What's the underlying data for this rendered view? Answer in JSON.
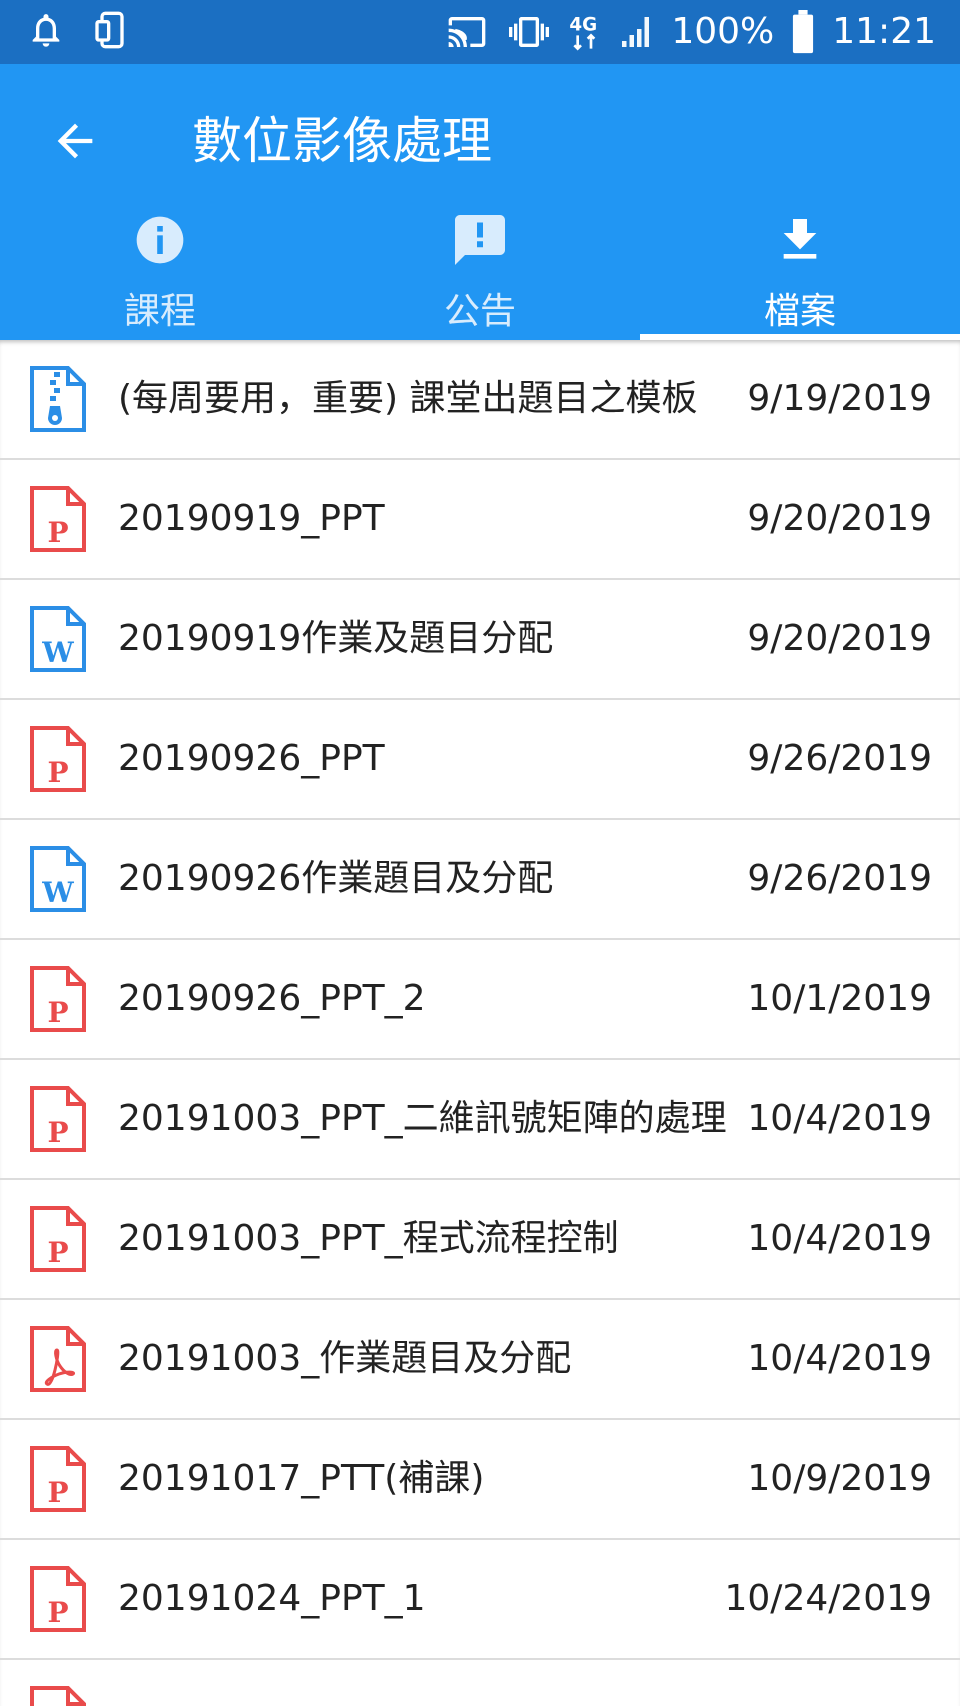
{
  "status_bar": {
    "battery": "100%",
    "time": "11:21",
    "network": "4G"
  },
  "appbar": {
    "title": "數位影像處理"
  },
  "tabs": [
    {
      "label": "課程",
      "icon": "info-icon",
      "active": false
    },
    {
      "label": "公告",
      "icon": "announcement-icon",
      "active": false
    },
    {
      "label": "檔案",
      "icon": "download-icon",
      "active": true
    }
  ],
  "colors": {
    "status_bar": "#1b6fc2",
    "primary": "#2196f3",
    "ppt_red": "#e94b4b",
    "word_blue": "#2b8ee6"
  },
  "files": [
    {
      "name": "(每周要用，重要) 課堂出題目之模板",
      "date": "9/19/2019",
      "type": "zip"
    },
    {
      "name": "20190919_PPT",
      "date": "9/20/2019",
      "type": "ppt"
    },
    {
      "name": "20190919作業及題目分配",
      "date": "9/20/2019",
      "type": "word"
    },
    {
      "name": "20190926_PPT",
      "date": "9/26/2019",
      "type": "ppt"
    },
    {
      "name": "20190926作業題目及分配",
      "date": "9/26/2019",
      "type": "word"
    },
    {
      "name": "20190926_PPT_2",
      "date": "10/1/2019",
      "type": "ppt"
    },
    {
      "name": "20191003_PPT_二維訊號矩陣的處理",
      "date": "10/4/2019",
      "type": "ppt"
    },
    {
      "name": "20191003_PPT_程式流程控制",
      "date": "10/4/2019",
      "type": "ppt"
    },
    {
      "name": "20191003_作業題目及分配",
      "date": "10/4/2019",
      "type": "pdf"
    },
    {
      "name": "20191017_PTT(補課)",
      "date": "10/9/2019",
      "type": "ppt"
    },
    {
      "name": "20191024_PPT_1",
      "date": "10/24/2019",
      "type": "ppt"
    },
    {
      "name": "",
      "date": "",
      "type": "ppt"
    }
  ]
}
